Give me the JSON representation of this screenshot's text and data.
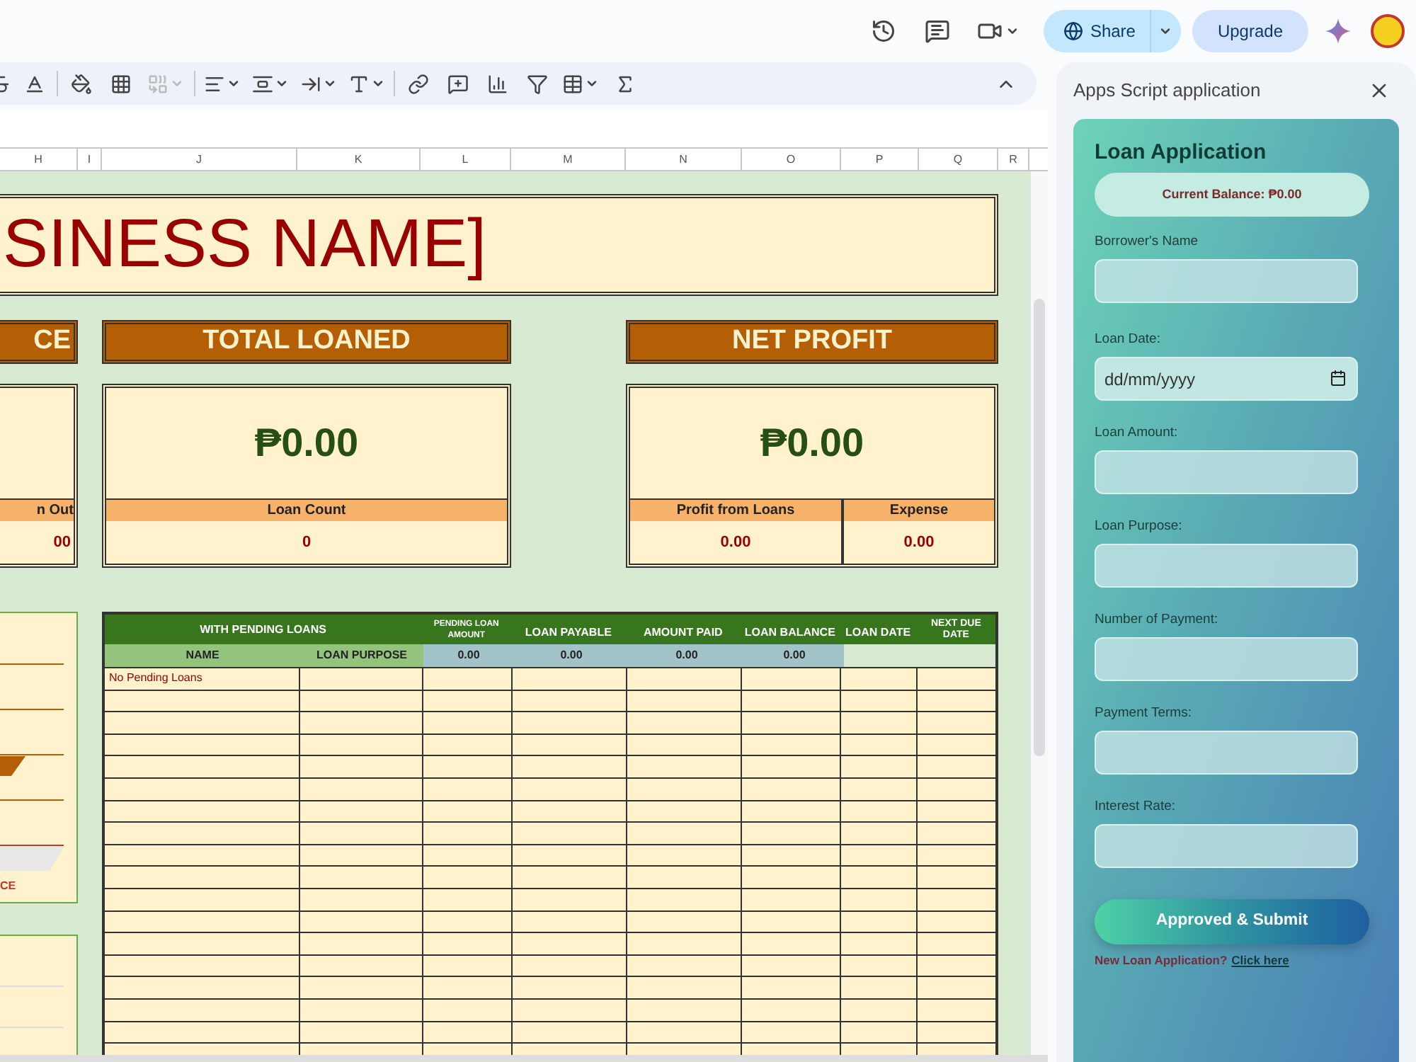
{
  "topbar": {
    "share": "Share",
    "upgrade": "Upgrade"
  },
  "column_headers": [
    "H",
    "I",
    "J",
    "K",
    "L",
    "M",
    "N",
    "O",
    "P",
    "Q",
    "R"
  ],
  "sheet": {
    "title": "SINESS NAME]",
    "summary_cards": [
      {
        "kind": "partial",
        "title": "CE",
        "subcells": [
          {
            "label": "n Out",
            "value": "00"
          }
        ]
      },
      {
        "kind": "full",
        "title": "TOTAL LOANED",
        "amount": "₱0.00",
        "subcells": [
          {
            "label": "Loan Count",
            "value": "0"
          }
        ]
      },
      {
        "kind": "full",
        "title": "NET PROFIT",
        "amount": "₱0.00",
        "subcells": [
          {
            "label": "Profit from Loans",
            "value": "0.00"
          },
          {
            "label": "Expense",
            "value": "0.00"
          }
        ]
      }
    ],
    "left_chart_label": "CE",
    "table": {
      "group_header": "WITH PENDING LOANS",
      "columns": [
        "PENDING LOAN AMOUNT",
        "LOAN PAYABLE",
        "AMOUNT PAID",
        "LOAN BALANCE",
        "LOAN DATE",
        "NEXT DUE DATE"
      ],
      "subheaders": [
        "NAME",
        "LOAN PURPOSE"
      ],
      "totals": [
        "0.00",
        "0.00",
        "0.00",
        "0.00"
      ],
      "rows": [
        {
          "name": "No Pending Loans"
        }
      ]
    }
  },
  "panel": {
    "title": "Apps Script application",
    "form_title": "Loan Application",
    "balance": "Current Balance: ₱0.00",
    "fields": [
      {
        "label": "Borrower's Name",
        "kind": "text"
      },
      {
        "label": "Loan Date:",
        "kind": "date",
        "placeholder": "dd/mm/yyyy"
      },
      {
        "label": "Loan Amount:",
        "kind": "text"
      },
      {
        "label": "Loan Purpose:",
        "kind": "text"
      },
      {
        "label": "Number of Payment:",
        "kind": "text"
      },
      {
        "label": "Payment Terms:",
        "kind": "text"
      },
      {
        "label": "Interest Rate:",
        "kind": "text"
      }
    ],
    "submit": "Approved & Submit",
    "footer_text": "New Loan Application?",
    "footer_link": "Click here"
  }
}
